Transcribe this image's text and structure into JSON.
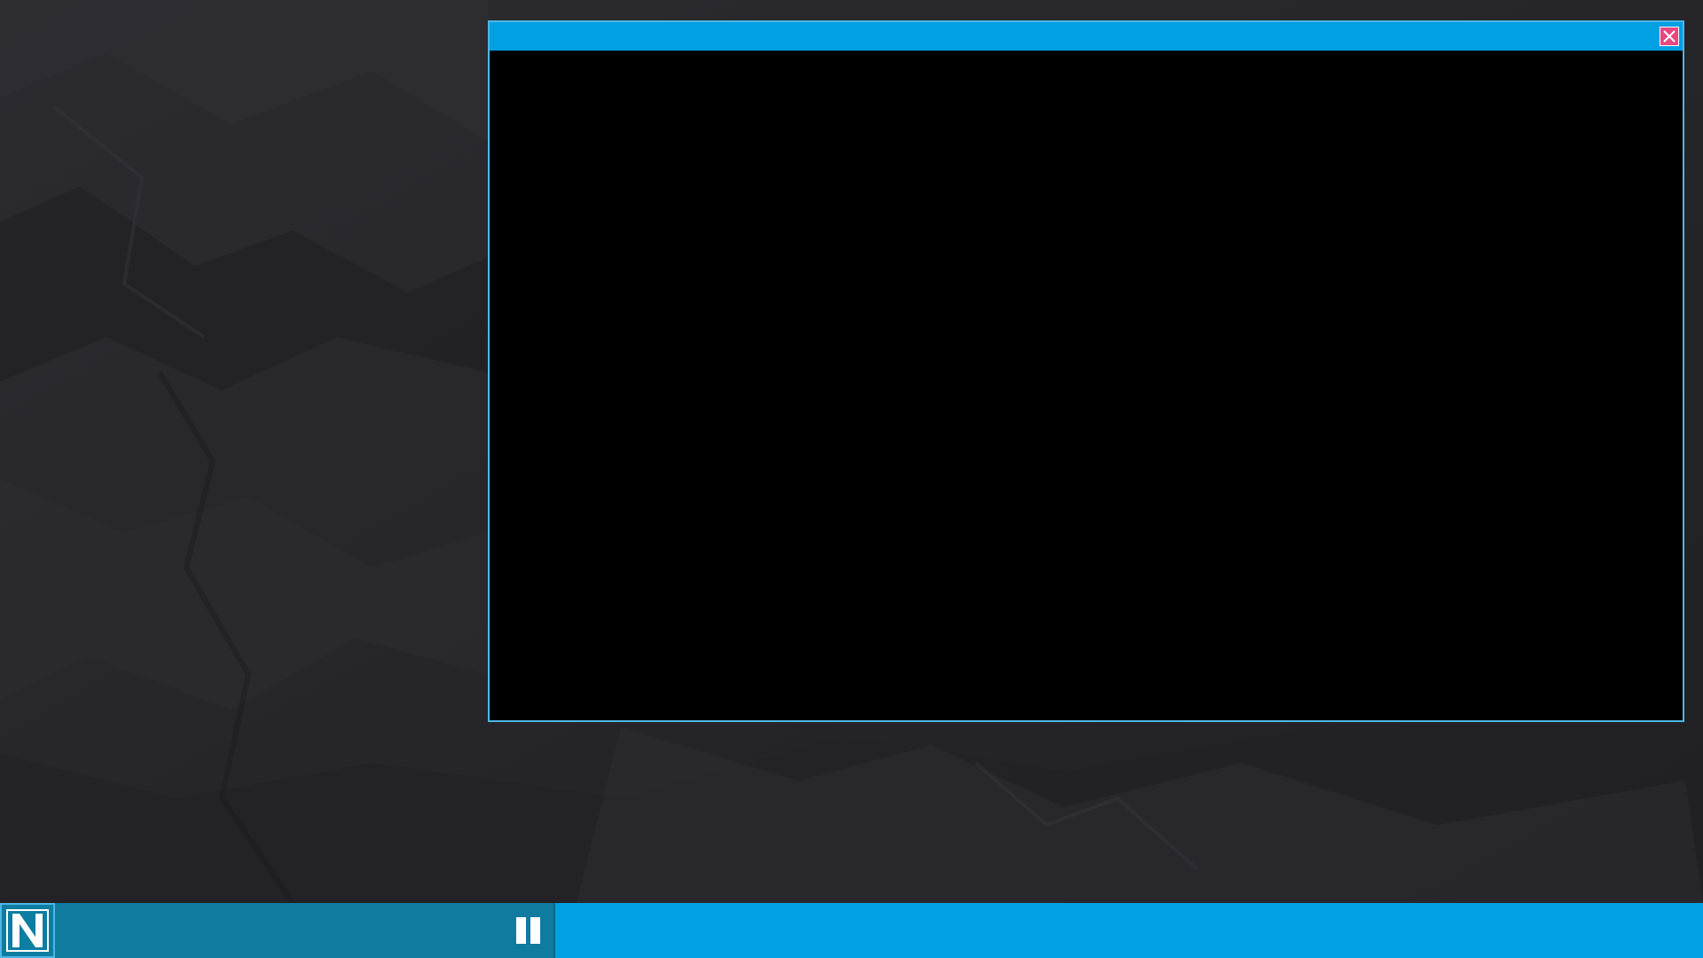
{
  "window": {
    "title": ""
  },
  "taskbar": {
    "media_label": "",
    "start_icon": "n-logo-icon",
    "pause_icon": "pause-icon"
  },
  "icons": {
    "close": "close-icon"
  },
  "colors": {
    "accent": "#00a0e3",
    "taskbar_panel": "#0f7b9f",
    "window_border": "#4fb6e6",
    "close_button": "#e8477f",
    "desktop_background": "#26262a",
    "window_content": "#000000"
  }
}
